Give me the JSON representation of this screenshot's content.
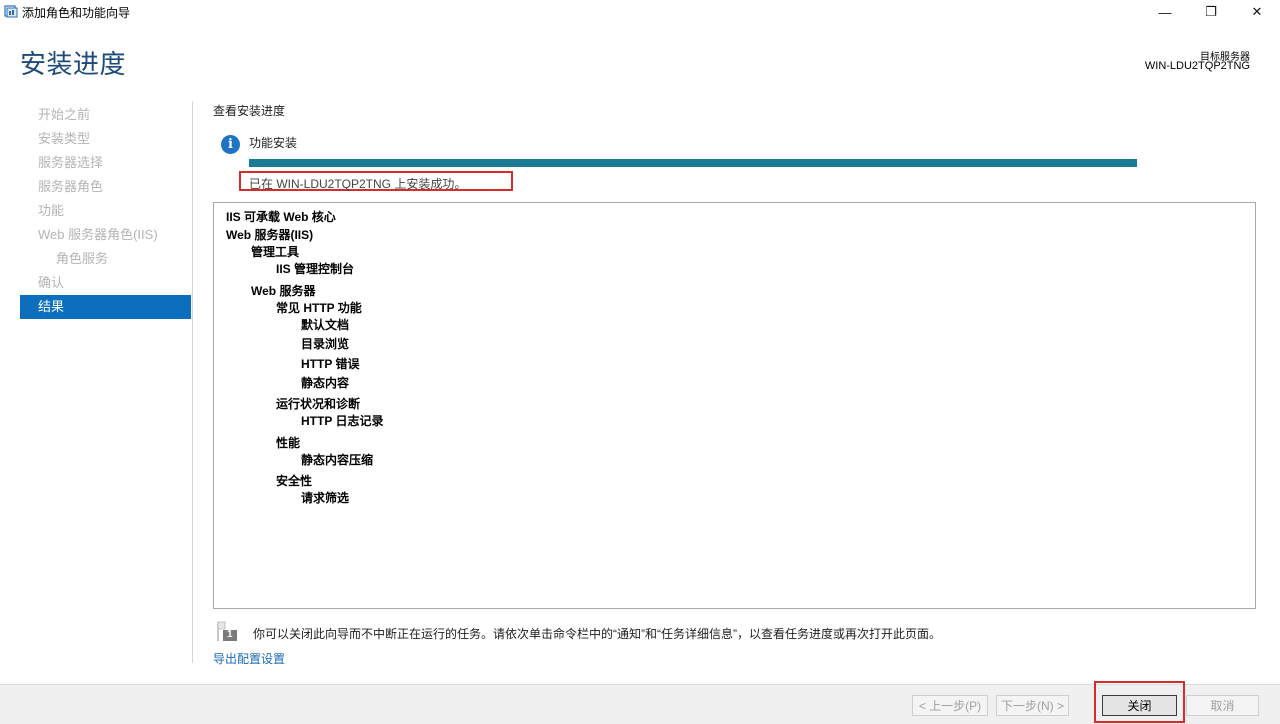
{
  "window": {
    "title": "添加角色和功能向导",
    "icon": "server-manager-icon",
    "controls": {
      "minimize": "—",
      "maximize": "❐",
      "close": "✕"
    }
  },
  "header": {
    "page_title": "安装进度",
    "target_label": "目标服务器",
    "target_server": "WIN-LDU2TQP2TNG"
  },
  "nav": {
    "items": [
      {
        "label": "开始之前",
        "active": false
      },
      {
        "label": "安装类型",
        "active": false
      },
      {
        "label": "服务器选择",
        "active": false
      },
      {
        "label": "服务器角色",
        "active": false
      },
      {
        "label": "功能",
        "active": false
      },
      {
        "label": "Web 服务器角色(IIS)",
        "active": false
      },
      {
        "label": "角色服务",
        "active": false
      },
      {
        "label": "确认",
        "active": false
      },
      {
        "label": "结果",
        "active": true
      }
    ]
  },
  "main": {
    "section_title": "查看安装进度",
    "install_label": "功能安装",
    "progress_percent": 100,
    "status_text": "已在 WIN-LDU2TQP2TNG 上安装成功。",
    "tree": [
      {
        "text": "IIS 可承载 Web 核心",
        "level": 0
      },
      {
        "text": "Web 服务器(IIS)",
        "level": 0
      },
      {
        "text": "管理工具",
        "level": 1
      },
      {
        "text": "IIS 管理控制台",
        "level": 2
      },
      {
        "text": "Web 服务器",
        "level": 1
      },
      {
        "text": "常见 HTTP 功能",
        "level": 2
      },
      {
        "text": "默认文档",
        "level": 3
      },
      {
        "text": "目录浏览",
        "level": 3
      },
      {
        "text": "HTTP 错误",
        "level": 3
      },
      {
        "text": "静态内容",
        "level": 3
      },
      {
        "text": "运行状况和诊断",
        "level": 2
      },
      {
        "text": "HTTP 日志记录",
        "level": 3
      },
      {
        "text": "性能",
        "level": 2
      },
      {
        "text": "静态内容压缩",
        "level": 3
      },
      {
        "text": "安全性",
        "level": 2
      },
      {
        "text": "请求筛选",
        "level": 3
      }
    ],
    "note_badge": "1",
    "note_text": "你可以关闭此向导而不中断正在运行的任务。请依次单击命令栏中的“通知”和“任务详细信息”，以查看任务进度或再次打开此页面。",
    "export_link": "导出配置设置"
  },
  "footer": {
    "prev_label": "< 上一步(P)",
    "next_label": "下一步(N) >",
    "close_label": "关闭",
    "cancel_label": "取消"
  },
  "colors": {
    "accent": "#0b6fbe",
    "progress": "#1b7b96",
    "highlight": "#d82b2b",
    "title": "#1e4a7b"
  }
}
